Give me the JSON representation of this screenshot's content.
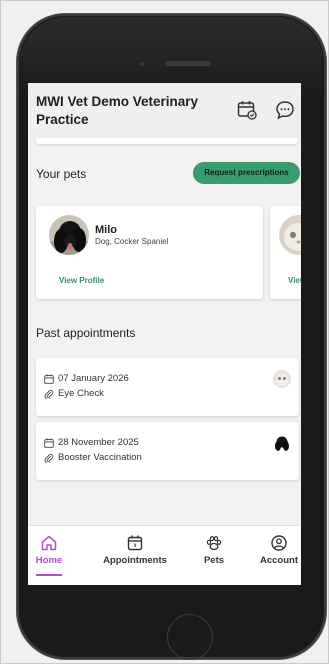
{
  "header": {
    "practice_name": "MWI Vet Demo Veterinary Practice",
    "calendar_icon": "calendar-check-icon",
    "chat_icon": "chat-bubble-icon"
  },
  "pets_section": {
    "title": "Your pets",
    "request_button": "Request prescriptions",
    "pets": [
      {
        "name": "Milo",
        "breed": "Dog, Cocker Spaniel",
        "link": "View Profile"
      },
      {
        "link": "View"
      }
    ]
  },
  "appointments_section": {
    "title": "Past appointments",
    "items": [
      {
        "date": "07 January 2026",
        "reason": "Eye Check"
      },
      {
        "date": "28 November 2025",
        "reason": "Booster Vaccination"
      }
    ]
  },
  "nav": {
    "items": [
      {
        "label": "Home",
        "icon": "home-icon",
        "active": true
      },
      {
        "label": "Appointments",
        "icon": "calendar-icon"
      },
      {
        "label": "Pets",
        "icon": "paw-icon"
      },
      {
        "label": "Account",
        "icon": "user-circle-icon"
      }
    ]
  },
  "colors": {
    "accent": "#b44fc8",
    "primary_button": "#3a9b6f",
    "link_green": "#3a8f62"
  }
}
